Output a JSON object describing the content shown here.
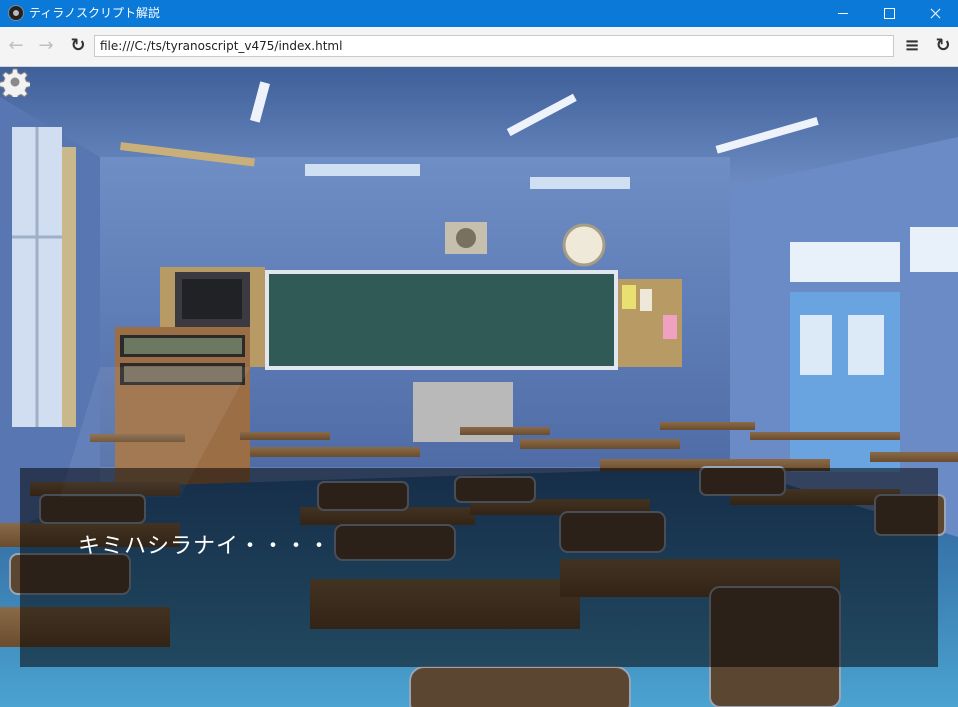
{
  "window": {
    "title": "ティラノスクリプト解説",
    "icon": "tyrano-app-icon",
    "controls": [
      "minimize-icon",
      "maximize-icon",
      "close-icon"
    ]
  },
  "toolbar": {
    "back_icon": "←",
    "forward_icon": "→",
    "reload_icon": "↻",
    "menu_icon": "≡",
    "url": "file:///C:/ts/tyranoscript_v475/index.html"
  },
  "game": {
    "background": "classroom",
    "message": "キミハシラナイ・・・・",
    "settings_icon": "gear-icon"
  },
  "colors": {
    "titlebar": "#0a79d8",
    "wall": "#5f7fb8",
    "chalkboard": "#2f5a55",
    "desk": "#7a5a3a"
  }
}
